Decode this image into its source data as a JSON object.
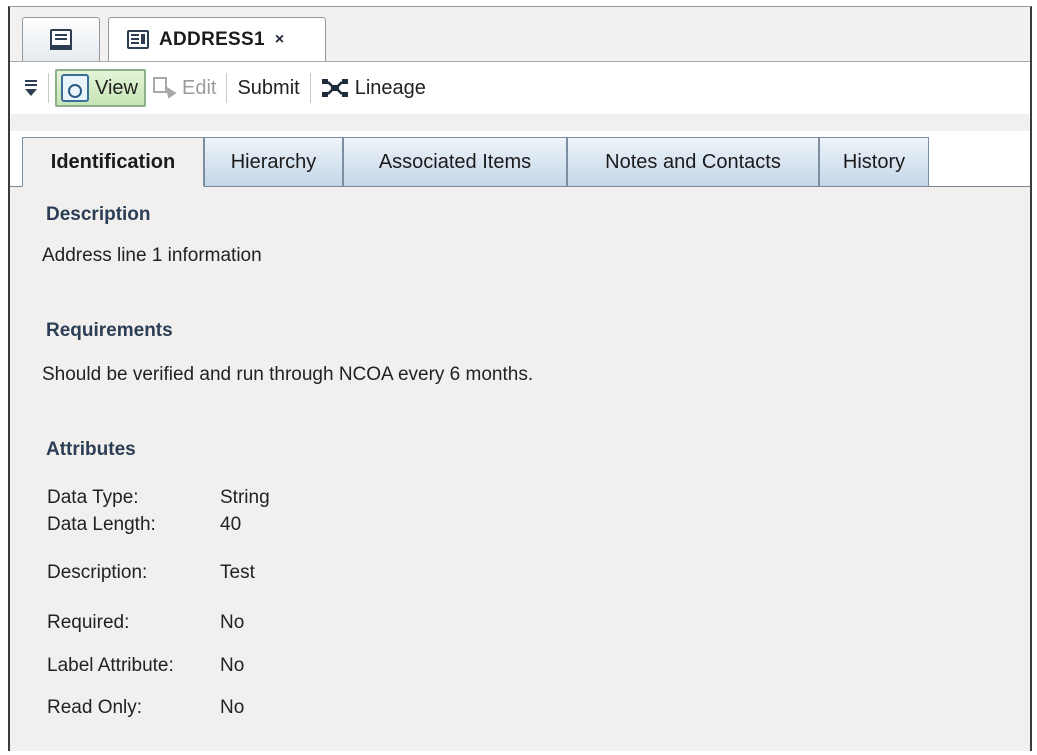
{
  "doc_tab": {
    "title": "ADDRESS1",
    "close": "×"
  },
  "toolbar": {
    "view": "View",
    "edit": "Edit",
    "submit": "Submit",
    "lineage": "Lineage"
  },
  "tabs": [
    "Identification",
    "Hierarchy",
    "Associated Items",
    "Notes and Contacts",
    "History"
  ],
  "sections": {
    "description_heading": "Description",
    "description_text": "Address line 1 information",
    "requirements_heading": "Requirements",
    "requirements_text": "Should be verified and run through NCOA every 6 months.",
    "attributes_heading": "Attributes"
  },
  "attributes": [
    {
      "key": "Data Type:",
      "value": "String"
    },
    {
      "key": "Data Length:",
      "value": "40"
    },
    {
      "key": "Description:",
      "value": "Test"
    },
    {
      "key": "Required:",
      "value": "No"
    },
    {
      "key": "Label Attribute:",
      "value": "No"
    },
    {
      "key": "Read Only:",
      "value": "No"
    }
  ]
}
